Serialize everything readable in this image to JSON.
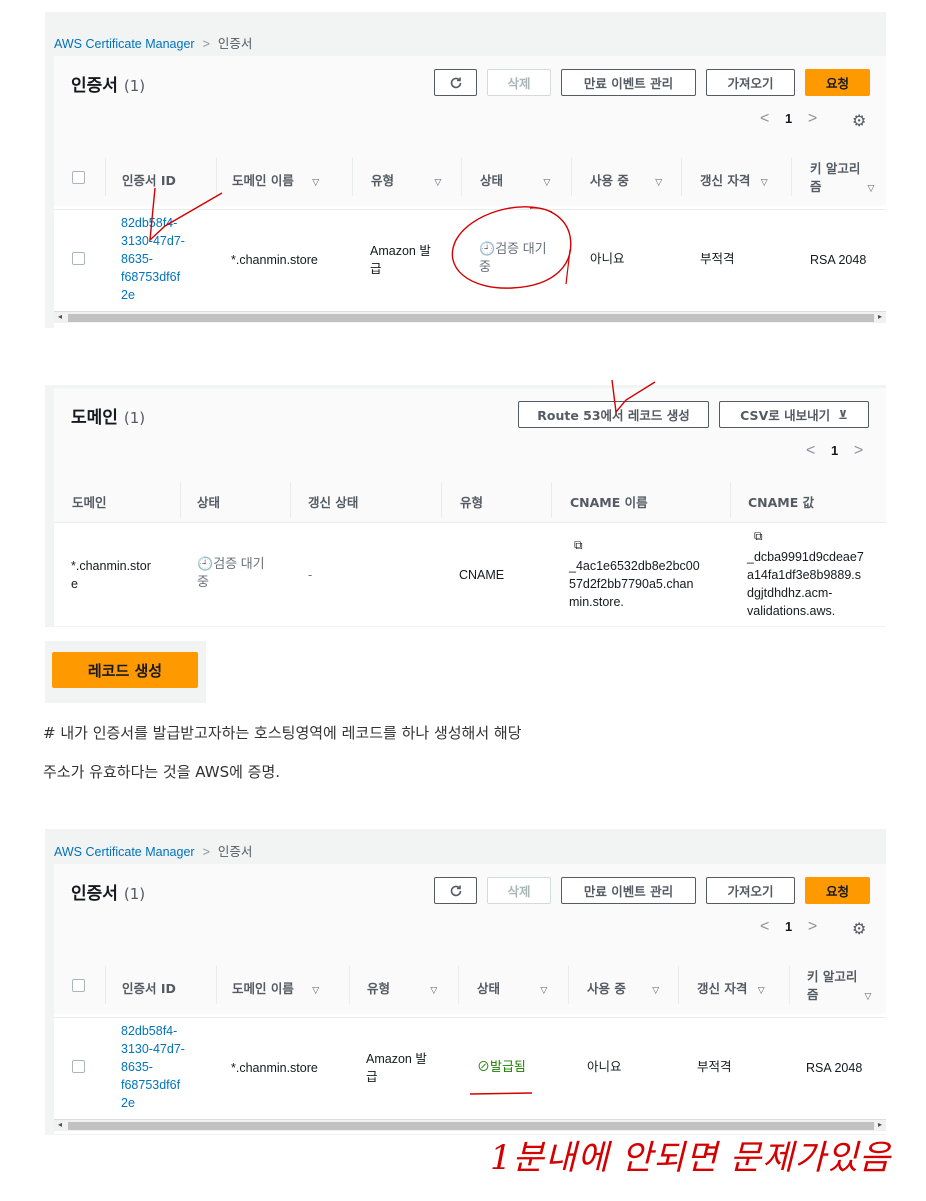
{
  "shot1": {
    "breadcrumb": {
      "root": "AWS Certificate Manager",
      "current": "인증서"
    },
    "title": "인증서",
    "count": "(1)",
    "buttons": {
      "delete": "삭제",
      "expiry": "만료 이벤트 관리",
      "import": "가져오기",
      "request": "요청"
    },
    "page": "1",
    "headers": {
      "id": "인증서 ID",
      "domain": "도메인 이름",
      "type": "유형",
      "status": "상태",
      "inuse": "사용 중",
      "renew": "갱신 자격",
      "key1": "키 알고리",
      "key2": "즘"
    },
    "row": {
      "id": [
        "82db58f4-",
        "3130-47d7-",
        "8635-",
        "f68753df6f",
        "2e"
      ],
      "domain": "*.chanmin.store",
      "type1": "Amazon 발",
      "type2": "급",
      "status1": "검증 대기",
      "status2": "중",
      "inuse": "아니요",
      "renew": "부적격",
      "key": "RSA 2048"
    }
  },
  "shot2": {
    "title": "도메인",
    "count": "(1)",
    "buttons": {
      "route53": "Route 53에서 레코드 생성",
      "csv": "CSV로 내보내기"
    },
    "page": "1",
    "headers": {
      "domain": "도메인",
      "status": "상태",
      "renew": "갱신 상태",
      "type": "유형",
      "cname_name": "CNAME 이름",
      "cname_value": "CNAME 값"
    },
    "row": {
      "domain1": "*.chanmin.stor",
      "domain2": "e",
      "status1": "검증 대기",
      "status2": "중",
      "renew": "-",
      "type": "CNAME",
      "cname_name": [
        "_4ac1e6532db8e2bc00",
        "57d2f2bb7790a5.chan",
        "min.store."
      ],
      "cname_value": [
        "_dcba9991d9cdeae7",
        "a14fa1df3e8b9889.s",
        "dgjtdhdhz.acm-",
        "validations.aws."
      ]
    }
  },
  "create_button": "레코드 생성",
  "note": {
    "line1": "# 내가 인증서를 발급받고자하는 호스팅영역에 레코드를 하나 생성해서 해당",
    "line2": "주소가 유효하다는 것을 AWS에 증명."
  },
  "shot3": {
    "breadcrumb": {
      "root": "AWS Certificate Manager",
      "current": "인증서"
    },
    "title": "인증서",
    "count": "(1)",
    "buttons": {
      "delete": "삭제",
      "expiry": "만료 이벤트 관리",
      "import": "가져오기",
      "request": "요청"
    },
    "page": "1",
    "headers": {
      "id": "인증서 ID",
      "domain": "도메인 이름",
      "type": "유형",
      "status": "상태",
      "inuse": "사용 중",
      "renew": "갱신 자격",
      "key1": "키 알고리",
      "key2": "즘"
    },
    "row": {
      "id": [
        "82db58f4-",
        "3130-47d7-",
        "8635-",
        "f68753df6f",
        "2e"
      ],
      "domain": "*.chanmin.store",
      "type1": "Amazon 발",
      "type2": "급",
      "status": "발급됨",
      "inuse": "아니요",
      "renew": "부적격",
      "key": "RSA 2048"
    }
  },
  "handwriting": "1분내에 안되면 문제가있음",
  "colors": {
    "accent": "#ff9900",
    "link": "#0073bb",
    "success": "#1d8102",
    "ink": "#d40000"
  }
}
